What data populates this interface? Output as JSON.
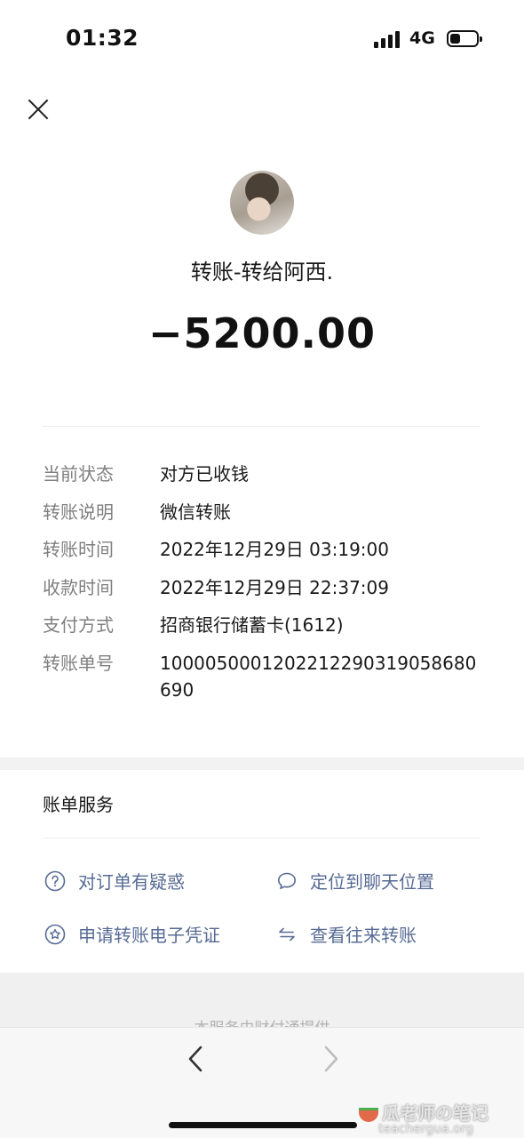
{
  "status_bar": {
    "time": "01:32",
    "network": "4G"
  },
  "header": {
    "title": "转账-转给阿西.",
    "amount": "−5200.00"
  },
  "details": [
    {
      "label": "当前状态",
      "value": "对方已收钱"
    },
    {
      "label": "转账说明",
      "value": "微信转账"
    },
    {
      "label": "转账时间",
      "value": "2022年12月29日 03:19:00"
    },
    {
      "label": "收款时间",
      "value": "2022年12月29日 22:37:09"
    },
    {
      "label": "支付方式",
      "value": "招商银行储蓄卡(1612)"
    },
    {
      "label": "转账单号",
      "value": "1000050001202212290319058680690"
    }
  ],
  "services": {
    "title": "账单服务",
    "items": [
      {
        "label": "对订单有疑惑",
        "icon": "question-circle-icon"
      },
      {
        "label": "定位到聊天位置",
        "icon": "chat-bubble-icon"
      },
      {
        "label": "申请转账电子凭证",
        "icon": "star-badge-icon"
      },
      {
        "label": "查看往来转账",
        "icon": "swap-arrows-icon"
      }
    ]
  },
  "footer": {
    "note": "本服务由财付通提供"
  },
  "watermark": {
    "name": "瓜老师の笔记",
    "site": "teachergua.org"
  },
  "colors": {
    "link": "#576b95",
    "label": "#7f7f7f",
    "text": "#191919"
  }
}
